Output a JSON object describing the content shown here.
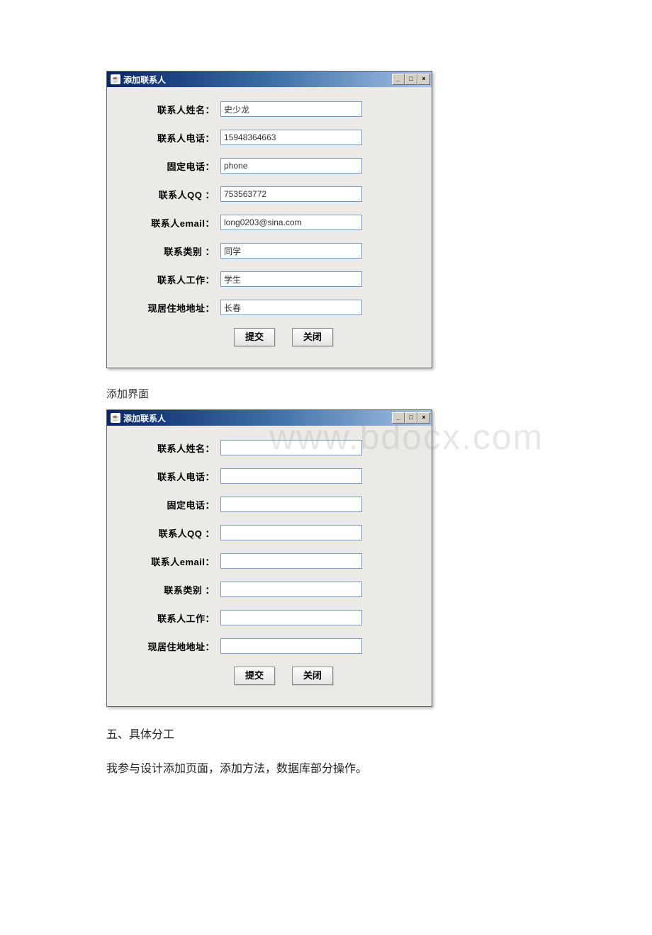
{
  "windowA": {
    "title": "添加联系人",
    "buttons": {
      "submit": "提交",
      "close": "关闭"
    },
    "fields": [
      {
        "label": "联系人姓名：",
        "value": "史少龙"
      },
      {
        "label": "联系人电话：",
        "value": "15948364663"
      },
      {
        "label": "固定电话：",
        "value": "phone"
      },
      {
        "label": "联系人QQ ：",
        "value": "753563772"
      },
      {
        "label": "联系人email：",
        "value": "long0203@sina.com"
      },
      {
        "label": "联系类别 ：",
        "value": "同学"
      },
      {
        "label": "联系人工作：",
        "value": "学生"
      },
      {
        "label": "现居住地地址：",
        "value": "长春"
      }
    ]
  },
  "caption": "添加界面",
  "watermark": "www.bdocx.com",
  "windowB": {
    "title": "添加联系人",
    "buttons": {
      "submit": "提交",
      "close": "关闭"
    },
    "fields": [
      {
        "label": "联系人姓名：",
        "value": ""
      },
      {
        "label": "联系人电话：",
        "value": ""
      },
      {
        "label": "固定电话：",
        "value": ""
      },
      {
        "label": "联系人QQ ：",
        "value": ""
      },
      {
        "label": "联系人email：",
        "value": ""
      },
      {
        "label": "联系类别 ：",
        "value": ""
      },
      {
        "label": "联系人工作：",
        "value": ""
      },
      {
        "label": "现居住地地址：",
        "value": ""
      }
    ]
  },
  "section_title": "五、具体分工",
  "section_body": "我参与设计添加页面，添加方法，数据库部分操作。"
}
